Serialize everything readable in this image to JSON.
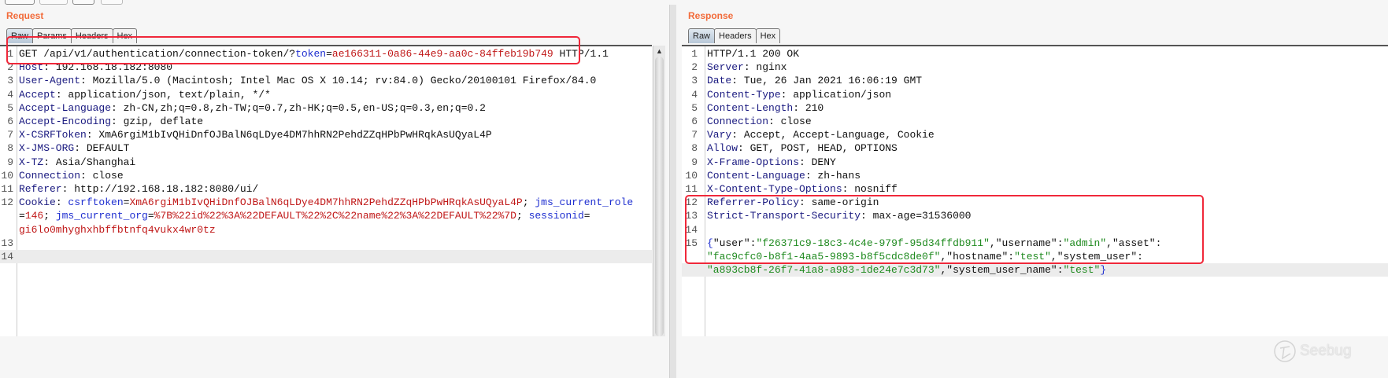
{
  "request": {
    "title": "Request",
    "tabs": [
      "Raw",
      "Params",
      "Headers",
      "Hex"
    ],
    "lines": [
      {
        "n": "1",
        "segs": [
          {
            "t": "GET /api/v1/authentication/connection-token/?",
            "c": "v"
          },
          {
            "t": "token",
            "c": "cn"
          },
          {
            "t": "=",
            "c": "v"
          },
          {
            "t": "ae166311-0a86-44e9-aa0c-84ffeb19b749",
            "c": "cv"
          },
          {
            "t": " HTTP/1.1",
            "c": "v"
          }
        ]
      },
      {
        "n": "2",
        "segs": [
          {
            "t": "Host",
            "c": "k"
          },
          {
            "t": ": 192.168.18.182:8080",
            "c": "v"
          }
        ]
      },
      {
        "n": "3",
        "segs": [
          {
            "t": "User-Agent",
            "c": "k"
          },
          {
            "t": ": Mozilla/5.0 (Macintosh; Intel Mac OS X 10.14; rv:84.0) Gecko/20100101 Firefox/84.0",
            "c": "v"
          }
        ]
      },
      {
        "n": "4",
        "segs": [
          {
            "t": "Accept",
            "c": "k"
          },
          {
            "t": ": application/json, text/plain, */*",
            "c": "v"
          }
        ]
      },
      {
        "n": "5",
        "segs": [
          {
            "t": "Accept-Language",
            "c": "k"
          },
          {
            "t": ": zh-CN,zh;q=0.8,zh-TW;q=0.7,zh-HK;q=0.5,en-US;q=0.3,en;q=0.2",
            "c": "v"
          }
        ]
      },
      {
        "n": "6",
        "segs": [
          {
            "t": "Accept-Encoding",
            "c": "k"
          },
          {
            "t": ": gzip, deflate",
            "c": "v"
          }
        ]
      },
      {
        "n": "7",
        "segs": [
          {
            "t": "X-CSRFToken",
            "c": "k"
          },
          {
            "t": ": XmA6rgiM1bIvQHiDnfOJBalN6qLDye4DM7hhRN2PehdZZqHPbPwHRqkAsUQyaL4P",
            "c": "v"
          }
        ]
      },
      {
        "n": "8",
        "segs": [
          {
            "t": "X-JMS-ORG",
            "c": "k"
          },
          {
            "t": ": DEFAULT",
            "c": "v"
          }
        ]
      },
      {
        "n": "9",
        "segs": [
          {
            "t": "X-TZ",
            "c": "k"
          },
          {
            "t": ": Asia/Shanghai",
            "c": "v"
          }
        ]
      },
      {
        "n": "10",
        "segs": [
          {
            "t": "Connection",
            "c": "k"
          },
          {
            "t": ": close",
            "c": "v"
          }
        ]
      },
      {
        "n": "11",
        "segs": [
          {
            "t": "Referer",
            "c": "k"
          },
          {
            "t": ": http://192.168.18.182:8080/ui/",
            "c": "v"
          }
        ]
      },
      {
        "n": "12",
        "segs": [
          {
            "t": "Cookie",
            "c": "k"
          },
          {
            "t": ": ",
            "c": "v"
          },
          {
            "t": "csrftoken",
            "c": "cn"
          },
          {
            "t": "=",
            "c": "v"
          },
          {
            "t": "XmA6rgiM1bIvQHiDnfOJBalN6qLDye4DM7hhRN2PehdZZqHPbPwHRqkAsUQyaL4P",
            "c": "cv"
          },
          {
            "t": "; ",
            "c": "v"
          },
          {
            "t": "jms_current_role",
            "c": "cn"
          }
        ]
      },
      {
        "n": "",
        "segs": [
          {
            "t": "=",
            "c": "v"
          },
          {
            "t": "146",
            "c": "cv"
          },
          {
            "t": "; ",
            "c": "v"
          },
          {
            "t": "jms_current_org",
            "c": "cn"
          },
          {
            "t": "=",
            "c": "v"
          },
          {
            "t": "%7B%22id%22%3A%22DEFAULT%22%2C%22name%22%3A%22DEFAULT%22%7D",
            "c": "cv"
          },
          {
            "t": "; ",
            "c": "v"
          },
          {
            "t": "sessionid",
            "c": "cn"
          },
          {
            "t": "=",
            "c": "v"
          }
        ]
      },
      {
        "n": "",
        "segs": [
          {
            "t": "gi6lo0mhyghxhbffbtnfq4vukx4wr0tz",
            "c": "cv"
          }
        ]
      },
      {
        "n": "13",
        "segs": []
      },
      {
        "n": "14",
        "segs": [],
        "hl": true
      }
    ]
  },
  "response": {
    "title": "Response",
    "tabs": [
      "Raw",
      "Headers",
      "Hex"
    ],
    "lines": [
      {
        "n": "1",
        "segs": [
          {
            "t": "HTTP/1.1 200 OK",
            "c": "v"
          }
        ]
      },
      {
        "n": "2",
        "segs": [
          {
            "t": "Server",
            "c": "k"
          },
          {
            "t": ": nginx",
            "c": "v"
          }
        ]
      },
      {
        "n": "3",
        "segs": [
          {
            "t": "Date",
            "c": "k"
          },
          {
            "t": ": Tue, 26 Jan 2021 16:06:19 GMT",
            "c": "v"
          }
        ]
      },
      {
        "n": "4",
        "segs": [
          {
            "t": "Content-Type",
            "c": "k"
          },
          {
            "t": ": application/json",
            "c": "v"
          }
        ]
      },
      {
        "n": "5",
        "segs": [
          {
            "t": "Content-Length",
            "c": "k"
          },
          {
            "t": ": 210",
            "c": "v"
          }
        ]
      },
      {
        "n": "6",
        "segs": [
          {
            "t": "Connection",
            "c": "k"
          },
          {
            "t": ": close",
            "c": "v"
          }
        ]
      },
      {
        "n": "7",
        "segs": [
          {
            "t": "Vary",
            "c": "k"
          },
          {
            "t": ": Accept, Accept-Language, Cookie",
            "c": "v"
          }
        ]
      },
      {
        "n": "8",
        "segs": [
          {
            "t": "Allow",
            "c": "k"
          },
          {
            "t": ": GET, POST, HEAD, OPTIONS",
            "c": "v"
          }
        ]
      },
      {
        "n": "9",
        "segs": [
          {
            "t": "X-Frame-Options",
            "c": "k"
          },
          {
            "t": ": DENY",
            "c": "v"
          }
        ]
      },
      {
        "n": "10",
        "segs": [
          {
            "t": "Content-Language",
            "c": "k"
          },
          {
            "t": ": zh-hans",
            "c": "v"
          }
        ]
      },
      {
        "n": "11",
        "segs": [
          {
            "t": "X-Content-Type-Options",
            "c": "k"
          },
          {
            "t": ": nosniff",
            "c": "v"
          }
        ]
      },
      {
        "n": "12",
        "segs": [
          {
            "t": "Referrer-Policy",
            "c": "k"
          },
          {
            "t": ": same-origin",
            "c": "v"
          }
        ]
      },
      {
        "n": "13",
        "segs": [
          {
            "t": "Strict-Transport-Security",
            "c": "k"
          },
          {
            "t": ": max-age=31536000",
            "c": "v"
          }
        ]
      },
      {
        "n": "14",
        "segs": []
      },
      {
        "n": "15",
        "segs": [
          {
            "t": "{",
            "c": "br"
          },
          {
            "t": "\"user\"",
            "c": "jk"
          },
          {
            "t": ":",
            "c": "v"
          },
          {
            "t": "\"f26371c9-18c3-4c4e-979f-95d34ffdb911\"",
            "c": "jv"
          },
          {
            "t": ",",
            "c": "v"
          },
          {
            "t": "\"username\"",
            "c": "jk"
          },
          {
            "t": ":",
            "c": "v"
          },
          {
            "t": "\"admin\"",
            "c": "jv"
          },
          {
            "t": ",",
            "c": "v"
          },
          {
            "t": "\"asset\"",
            "c": "jk"
          },
          {
            "t": ":",
            "c": "v"
          }
        ]
      },
      {
        "n": "",
        "segs": [
          {
            "t": "\"fac9cfc0-b8f1-4aa5-9893-b8f5cdc8de0f\"",
            "c": "jv"
          },
          {
            "t": ",",
            "c": "v"
          },
          {
            "t": "\"hostname\"",
            "c": "jk"
          },
          {
            "t": ":",
            "c": "v"
          },
          {
            "t": "\"test\"",
            "c": "jv"
          },
          {
            "t": ",",
            "c": "v"
          },
          {
            "t": "\"system_user\"",
            "c": "jk"
          },
          {
            "t": ":",
            "c": "v"
          }
        ]
      },
      {
        "n": "",
        "segs": [
          {
            "t": "\"a893cb8f-26f7-41a8-a983-1de24e7c3d73\"",
            "c": "jv"
          },
          {
            "t": ",",
            "c": "v"
          },
          {
            "t": "\"system_user_name\"",
            "c": "jk"
          },
          {
            "t": ":",
            "c": "v"
          },
          {
            "t": "\"test\"",
            "c": "jv"
          },
          {
            "t": "}",
            "c": "br"
          }
        ],
        "hl": true
      }
    ]
  },
  "watermark": "Seebug",
  "colors": {
    "title": "#f26b3a",
    "highlight_box": "#f0283a",
    "json_value": "#1f8a1f"
  }
}
